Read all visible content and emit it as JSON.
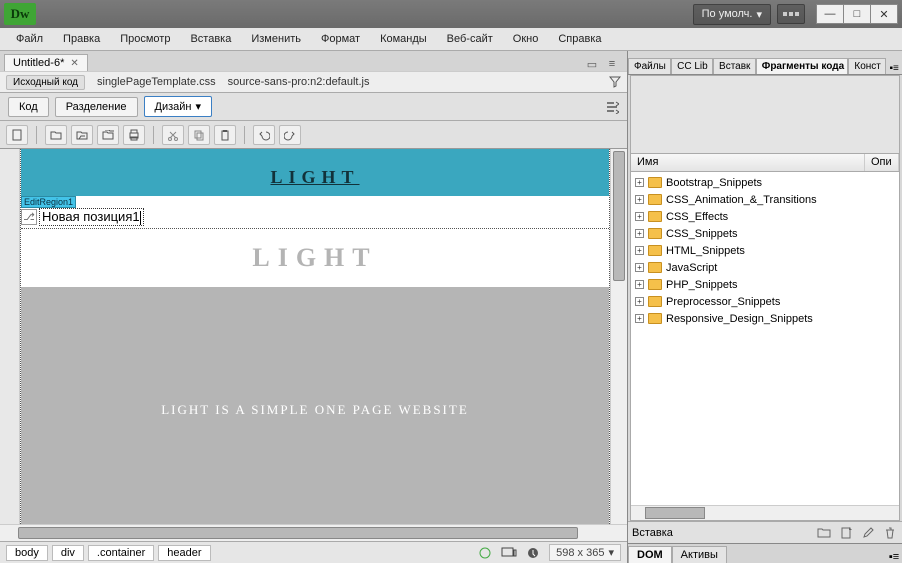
{
  "app": {
    "logo": "Dw",
    "workspace_label": "По умолч."
  },
  "menu": [
    "Файл",
    "Правка",
    "Просмотр",
    "Вставка",
    "Изменить",
    "Формат",
    "Команды",
    "Веб-сайт",
    "Окно",
    "Справка"
  ],
  "doc_tab": {
    "title": "Untitled-6*"
  },
  "src_bar": {
    "label": "Исходный код",
    "files": [
      "singlePageTemplate.css",
      "source-sans-pro:n2:default.js"
    ]
  },
  "view_buttons": {
    "code": "Код",
    "split": "Разделение",
    "design": "Дизайн"
  },
  "canvas": {
    "edit_region_label": "EditRegion1",
    "nav_link": "LIGHT",
    "placeholder_text": "Новая позиция1",
    "big_heading": "LIGHT",
    "hero_text": "LIGHT IS A SIMPLE ONE PAGE WEBSITE"
  },
  "status": {
    "crumbs": [
      "body",
      "div",
      ".container",
      "header"
    ],
    "dimensions": "598 x 365"
  },
  "panel_tabs": [
    "Файлы",
    "CC Lib",
    "Вставк",
    "Фрагменты кода",
    "Конст"
  ],
  "panel_active_tab": 3,
  "list_header": {
    "name": "Имя",
    "desc": "Опи"
  },
  "snippets": [
    "Bootstrap_Snippets",
    "CSS_Animation_&_Transitions",
    "CSS_Effects",
    "CSS_Snippets",
    "HTML_Snippets",
    "JavaScript",
    "PHP_Snippets",
    "Preprocessor_Snippets",
    "Responsive_Design_Snippets"
  ],
  "panel_footer_label": "Вставка",
  "bottom_tabs": [
    "DOM",
    "Активы"
  ]
}
